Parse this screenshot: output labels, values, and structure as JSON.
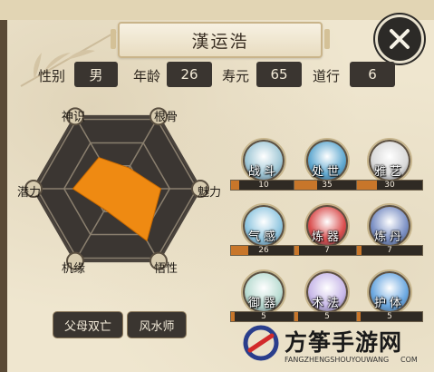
{
  "character": {
    "name": "漢运浩",
    "stats": [
      {
        "label": "性别",
        "value": "男"
      },
      {
        "label": "年龄",
        "value": "26"
      },
      {
        "label": "寿元",
        "value": "65"
      },
      {
        "label": "道行",
        "value": "6"
      }
    ]
  },
  "radar": {
    "axes": [
      "神识",
      "根骨",
      "魅力",
      "悟性",
      "机缘",
      "潜力"
    ],
    "values": [
      0.45,
      0.3,
      0.55,
      0.75,
      0.3,
      0.55
    ],
    "fill_color": "#ef8a12"
  },
  "traits": [
    "父母双亡",
    "风水师"
  ],
  "skills": [
    {
      "name": "战斗",
      "value": "10",
      "level": 0.12,
      "icon": "sword-icon",
      "color": "#9fc7d6"
    },
    {
      "name": "处世",
      "value": "35",
      "level": 0.35,
      "icon": "chat-bubble-icon",
      "color": "#5fa8d0"
    },
    {
      "name": "雅艺",
      "value": "30",
      "level": 0.3,
      "icon": "brush-icon",
      "color": "#d9d9d9"
    },
    {
      "name": "气感",
      "value": "26",
      "level": 0.26,
      "icon": "swirl-icon",
      "color": "#8fc6e0"
    },
    {
      "name": "炼器",
      "value": "7",
      "level": 0.07,
      "icon": "furnace-icon",
      "color": "#d94c4c"
    },
    {
      "name": "炼丹",
      "value": "7",
      "level": 0.07,
      "icon": "pill-cauldron-icon",
      "color": "#7a8fc4"
    },
    {
      "name": "御器",
      "value": "5",
      "level": 0.05,
      "icon": "flying-sword-icon",
      "color": "#b9dcd2"
    },
    {
      "name": "术法",
      "value": "5",
      "level": 0.05,
      "icon": "spell-scroll-icon",
      "color": "#c7b7e8"
    },
    {
      "name": "护体",
      "value": "5",
      "level": 0.05,
      "icon": "shield-icon",
      "color": "#6aa7e0"
    }
  ],
  "close_icon": "close-icon",
  "watermark": {
    "title": "方筝手游网",
    "url": "FANGZHENGSHOUYOUWANG",
    "suffix": "COM"
  }
}
